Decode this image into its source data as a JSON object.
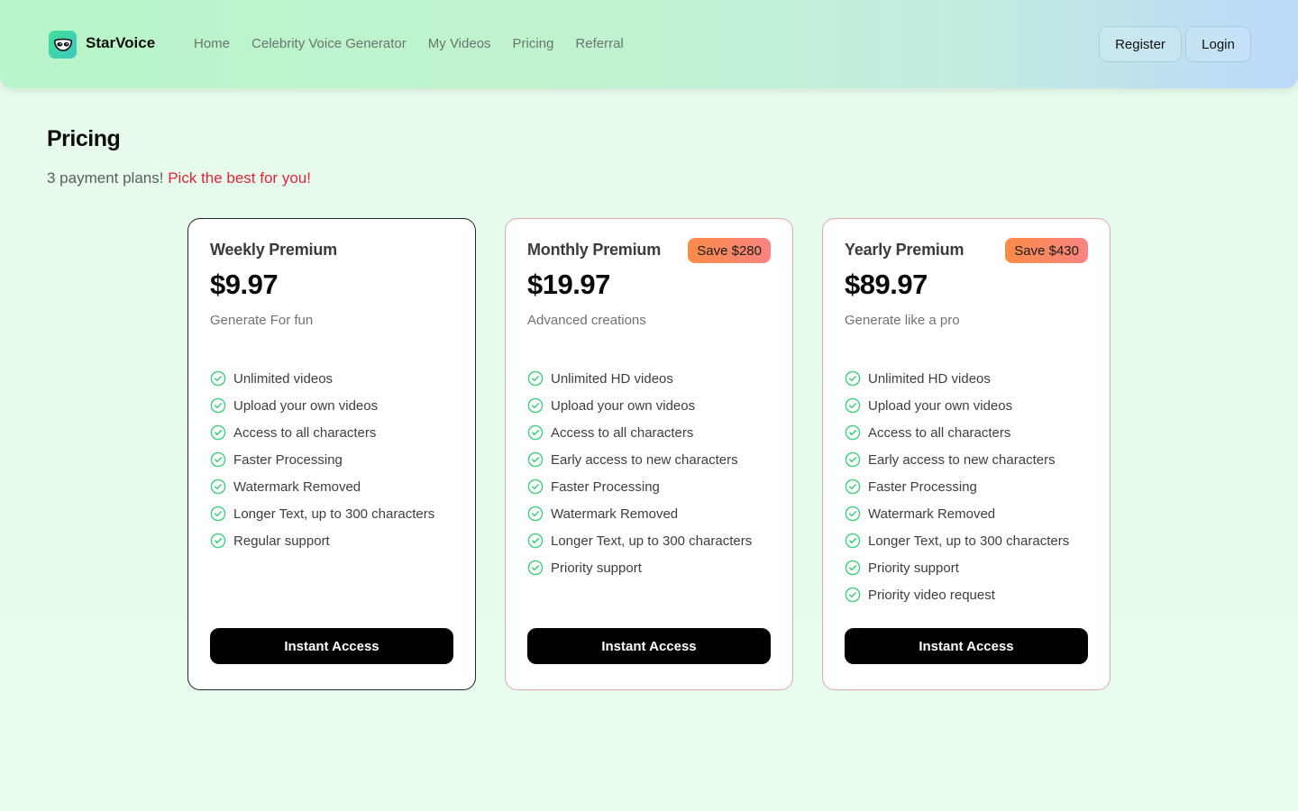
{
  "header": {
    "brand": "StarVoice",
    "logo_icon": "mask-face-icon",
    "nav": [
      "Home",
      "Celebrity Voice Generator",
      "My Videos",
      "Pricing",
      "Referral"
    ],
    "register_label": "Register",
    "login_label": "Login"
  },
  "page": {
    "title": "Pricing",
    "subtitle_plain": "3 payment plans!",
    "subtitle_highlight": "Pick the best for you!"
  },
  "colors": {
    "accent_red": "#e0243a",
    "check_green": "#3ccf7c",
    "badge_gradient_start": "#fb8b47",
    "badge_gradient_end": "#f98481",
    "cta_bg": "#000000"
  },
  "plans": [
    {
      "name": "Weekly Premium",
      "badge": "",
      "price": "$9.97",
      "tagline": "Generate For fun",
      "features": [
        "Unlimited videos",
        "Upload your own videos",
        "Access to all characters",
        "Faster Processing",
        "Watermark Removed",
        "Longer Text, up to 300 characters",
        "Regular support"
      ],
      "cta": "Instant Access"
    },
    {
      "name": "Monthly Premium",
      "badge": "Save $280",
      "price": "$19.97",
      "tagline": "Advanced creations",
      "features": [
        "Unlimited HD videos",
        "Upload your own videos",
        "Access to all characters",
        "Early access to new characters",
        "Faster Processing",
        "Watermark Removed",
        "Longer Text, up to 300 characters",
        "Priority support"
      ],
      "cta": "Instant Access"
    },
    {
      "name": "Yearly Premium",
      "badge": "Save $430",
      "price": "$89.97",
      "tagline": "Generate like a pro",
      "features": [
        "Unlimited HD videos",
        "Upload your own videos",
        "Access to all characters",
        "Early access to new characters",
        "Faster Processing",
        "Watermark Removed",
        "Longer Text, up to 300 characters",
        "Priority support",
        "Priority video request"
      ],
      "cta": "Instant Access"
    }
  ]
}
